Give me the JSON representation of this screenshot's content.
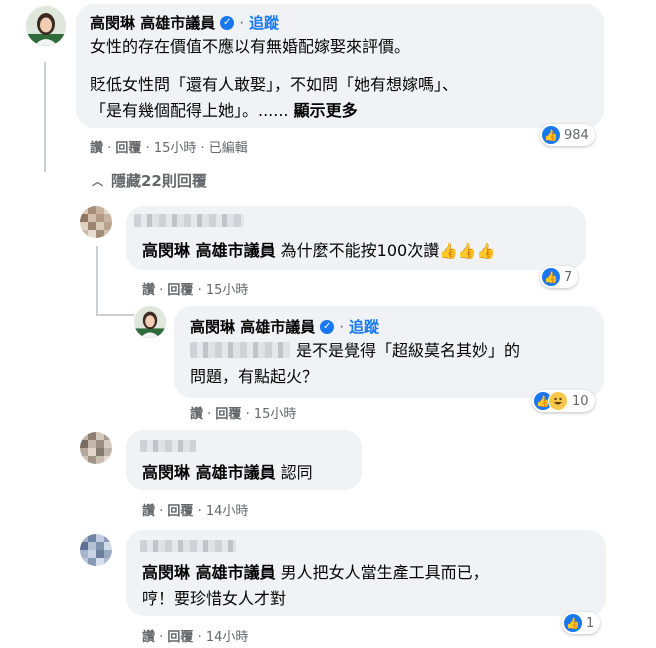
{
  "main_comment": {
    "author": "高閔琳 高雄市議員",
    "follow": "追蹤",
    "line1": "女性的存在價值不應以有無婚配嫁娶來評價。",
    "line2": "貶低女性問「還有人敢娶」，不如問「她有想嫁嗎」、",
    "line3": "「是有幾個配得上她」。......",
    "more": "顯示更多",
    "actions": {
      "like": "讚",
      "reply": "回覆",
      "time": "15小時",
      "edited": "已編輯"
    },
    "reaction_count": "984"
  },
  "hide_replies": "隱藏22則回覆",
  "reply1": {
    "mention": "高閔琳 高雄市議員",
    "text": "為什麼不能按100次讚",
    "emoji": "👍👍👍",
    "actions": {
      "like": "讚",
      "reply": "回覆",
      "time": "15小時"
    },
    "reaction_count": "7"
  },
  "reply1_sub": {
    "author": "高閔琳 高雄市議員",
    "follow": "追蹤",
    "line1": "是不是覺得「超級莫名其妙」的",
    "line2": "問題，有點起火？",
    "actions": {
      "like": "讚",
      "reply": "回覆",
      "time": "15小時"
    },
    "reaction_count": "10"
  },
  "reply2": {
    "mention": "高閔琳 高雄市議員",
    "text": "認同",
    "actions": {
      "like": "讚",
      "reply": "回覆",
      "time": "14小時"
    }
  },
  "reply3": {
    "mention": "高閔琳 高雄市議員",
    "line1": "男人把女人當生產工具而已，",
    "line2": "哼！要珍惜女人才對",
    "actions": {
      "like": "讚",
      "reply": "回覆",
      "time": "14小時"
    },
    "reaction_count": "1"
  },
  "colors": {
    "accent": "#1877f2",
    "bubble": "#f0f2f5",
    "meta": "#65676b"
  },
  "icons": {
    "verified": "verified-badge-icon",
    "like": "like-icon",
    "haha": "haha-icon",
    "chevron": "chevron-up-icon"
  }
}
